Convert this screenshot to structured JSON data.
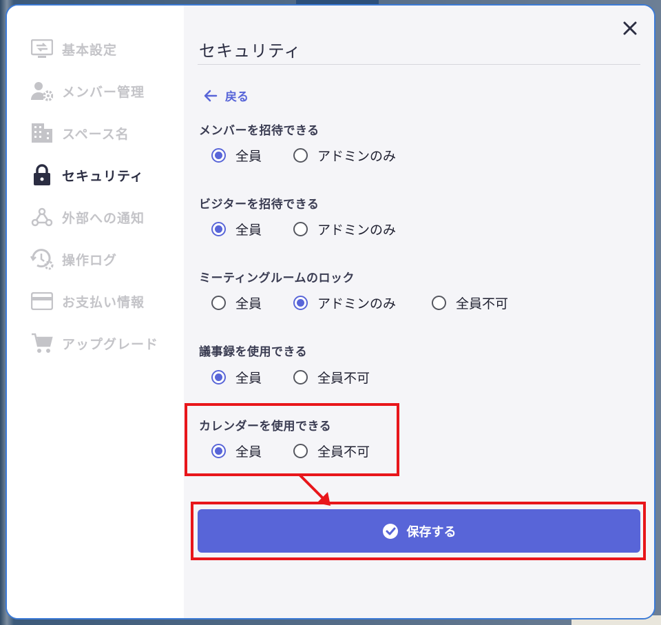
{
  "sidebar": {
    "items": [
      {
        "label": "基本設定",
        "icon": "settings-panel-icon",
        "active": false
      },
      {
        "label": "メンバー管理",
        "icon": "member-settings-icon",
        "active": false
      },
      {
        "label": "スペース名",
        "icon": "building-icon",
        "active": false
      },
      {
        "label": "セキュリティ",
        "icon": "lock-icon",
        "active": true
      },
      {
        "label": "外部への通知",
        "icon": "webhook-icon",
        "active": false
      },
      {
        "label": "操作ログ",
        "icon": "history-icon",
        "active": false
      },
      {
        "label": "お支払い情報",
        "icon": "credit-card-icon",
        "active": false
      },
      {
        "label": "アップグレード",
        "icon": "cart-icon",
        "active": false
      }
    ]
  },
  "main": {
    "title": "セキュリティ",
    "back_label": "戻る",
    "sections": [
      {
        "label": "メンバーを招待できる",
        "options": [
          "全員",
          "アドミンのみ"
        ],
        "selected": "全員"
      },
      {
        "label": "ビジターを招待できる",
        "options": [
          "全員",
          "アドミンのみ"
        ],
        "selected": "全員"
      },
      {
        "label": "ミーティングルームのロック",
        "options": [
          "全員",
          "アドミンのみ",
          "全員不可"
        ],
        "selected": "アドミンのみ"
      },
      {
        "label": "議事録を使用できる",
        "options": [
          "全員",
          "全員不可"
        ],
        "selected": "全員"
      },
      {
        "label": "カレンダーを使用できる",
        "options": [
          "全員",
          "全員不可"
        ],
        "selected": "全員"
      }
    ],
    "save_label": "保存する"
  },
  "colors": {
    "accent": "#5865d8",
    "highlight": "#e8161b",
    "sidebar_active": "#2b2d42",
    "sidebar_inactive": "#c4c4c8"
  }
}
